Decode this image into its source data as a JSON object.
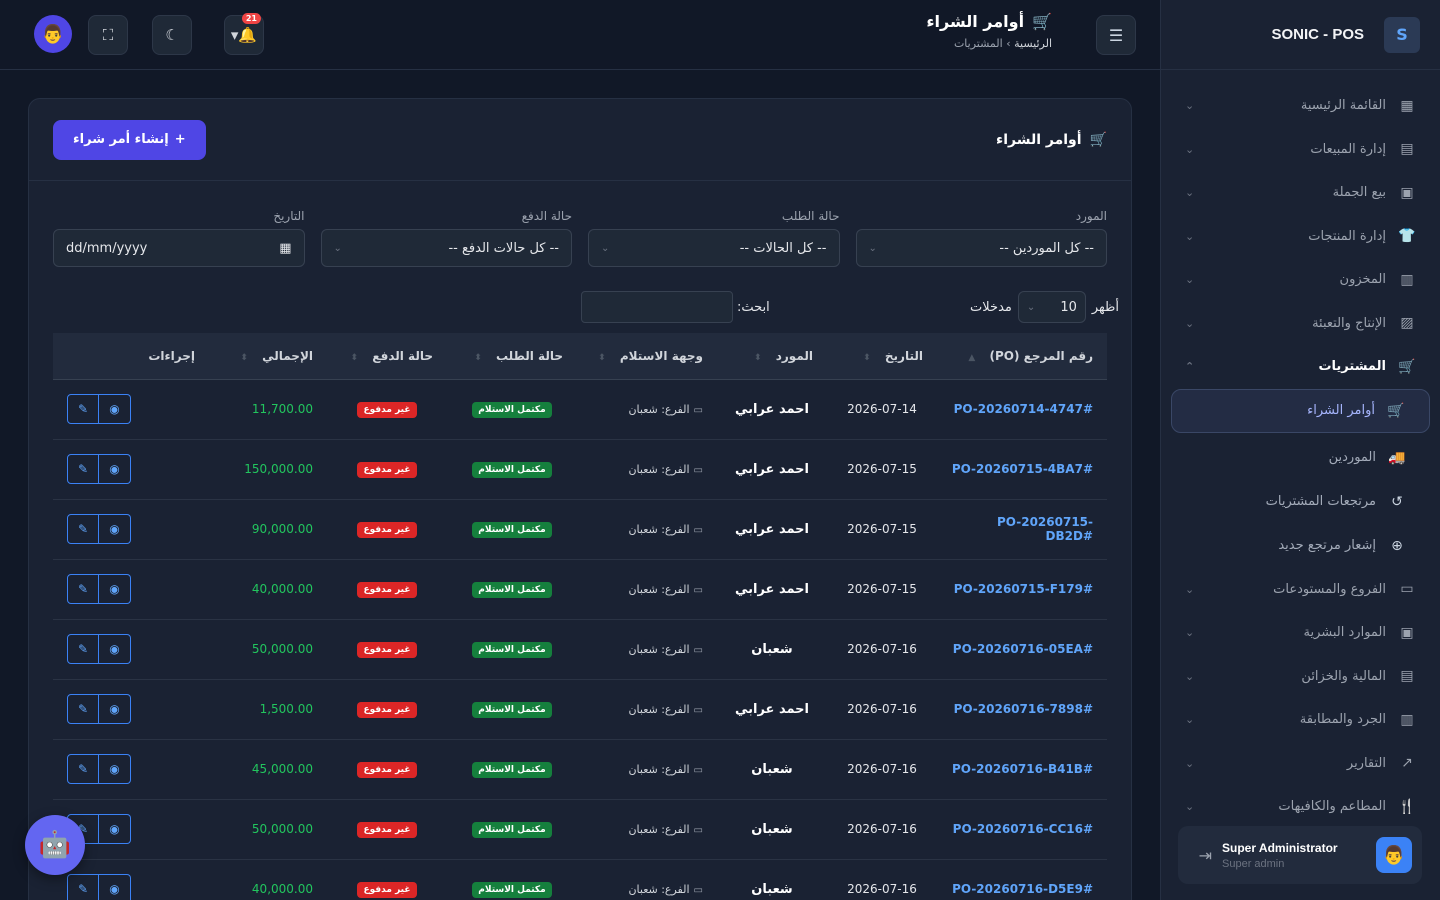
{
  "brand": {
    "name": "SONIC - POS",
    "logo_letter": "S"
  },
  "header": {
    "title": "أوامر الشراء",
    "crumb_home": "الرئيسية",
    "crumb_sep": "›",
    "crumb_current": "المشتريات",
    "notifications": "21"
  },
  "sidebar": {
    "items": [
      {
        "label": "القائمة الرئيسية",
        "icon": "▦"
      },
      {
        "label": "إدارة المبيعات",
        "icon": "▤"
      },
      {
        "label": "بيع الجملة",
        "icon": "▣"
      },
      {
        "label": "إدارة المنتجات",
        "icon": "👕"
      },
      {
        "label": "المخزون",
        "icon": "▥"
      },
      {
        "label": "الإنتاج والتعبئة",
        "icon": "▨"
      },
      {
        "label": "المشتريات",
        "icon": "🛒"
      }
    ],
    "sub_items": [
      {
        "label": "أوامر الشراء",
        "icon": "🛒"
      },
      {
        "label": "الموردين",
        "icon": "🚚"
      },
      {
        "label": "مرتجعات المشتريات",
        "icon": "↺"
      },
      {
        "label": "إشعار مرتجع جديد",
        "icon": "⊕"
      }
    ],
    "items_after": [
      {
        "label": "الفروع والمستودعات",
        "icon": "▭"
      },
      {
        "label": "الموارد البشرية",
        "icon": "▣"
      },
      {
        "label": "المالية والخزائن",
        "icon": "▤"
      },
      {
        "label": "الجرد والمطابقة",
        "icon": "▥"
      },
      {
        "label": "التقارير",
        "icon": "↗"
      },
      {
        "label": "المطاعم والكافيهات",
        "icon": "🍴"
      }
    ],
    "user": {
      "name": "Super Administrator",
      "role": "Super admin"
    }
  },
  "card": {
    "title": "أوامر الشراء",
    "create_label": "إنشاء أمر شراء"
  },
  "filters": {
    "supplier": {
      "label": "المورد",
      "value": "-- كل الموردين --"
    },
    "order_status": {
      "label": "حالة الطلب",
      "value": "-- كل الحالات --"
    },
    "payment_status": {
      "label": "حالة الدفع",
      "value": "-- كل حالات الدفع --"
    },
    "date": {
      "label": "التاريخ",
      "placeholder": "dd/mm/yyyy"
    }
  },
  "table_controls": {
    "show": "أظهر",
    "length": "10",
    "entries": "مدخلات",
    "search": "ابحث:"
  },
  "table": {
    "headers": [
      "رقم المرجع (PO)",
      "التاريخ",
      "المورد",
      "وجهة الاستلام",
      "حالة الطلب",
      "حالة الدفع",
      "الإجمالي",
      "إجراءات"
    ],
    "rows": [
      {
        "ref": "PO-20260714-4747#",
        "date": "2026-07-14",
        "supplier": "احمد عرابي",
        "dest": "الفرع: شعبان",
        "order": "مكتمل الاستلام",
        "pay": "غير مدفوع",
        "total": "11,700.00"
      },
      {
        "ref": "PO-20260715-4BA7#",
        "date": "2026-07-15",
        "supplier": "احمد عرابي",
        "dest": "الفرع: شعبان",
        "order": "مكتمل الاستلام",
        "pay": "غير مدفوع",
        "total": "150,000.00"
      },
      {
        "ref": "PO-20260715-DB2D#",
        "date": "2026-07-15",
        "supplier": "احمد عرابي",
        "dest": "الفرع: شعبان",
        "order": "مكتمل الاستلام",
        "pay": "غير مدفوع",
        "total": "90,000.00"
      },
      {
        "ref": "PO-20260715-F179#",
        "date": "2026-07-15",
        "supplier": "احمد عرابي",
        "dest": "الفرع: شعبان",
        "order": "مكتمل الاستلام",
        "pay": "غير مدفوع",
        "total": "40,000.00"
      },
      {
        "ref": "PO-20260716-05EA#",
        "date": "2026-07-16",
        "supplier": "شعبان",
        "dest": "الفرع: شعبان",
        "order": "مكتمل الاستلام",
        "pay": "غير مدفوع",
        "total": "50,000.00"
      },
      {
        "ref": "PO-20260716-7898#",
        "date": "2026-07-16",
        "supplier": "احمد عرابي",
        "dest": "الفرع: شعبان",
        "order": "مكتمل الاستلام",
        "pay": "غير مدفوع",
        "total": "1,500.00"
      },
      {
        "ref": "PO-20260716-B41B#",
        "date": "2026-07-16",
        "supplier": "شعبان",
        "dest": "الفرع: شعبان",
        "order": "مكتمل الاستلام",
        "pay": "غير مدفوع",
        "total": "45,000.00"
      },
      {
        "ref": "PO-20260716-CC16#",
        "date": "2026-07-16",
        "supplier": "شعبان",
        "dest": "الفرع: شعبان",
        "order": "مكتمل الاستلام",
        "pay": "غير مدفوع",
        "total": "50,000.00"
      },
      {
        "ref": "PO-20260716-D5E9#",
        "date": "2026-07-16",
        "supplier": "شعبان",
        "dest": "الفرع: شعبان",
        "order": "مكتمل الاستلام",
        "pay": "غير مدفوع",
        "total": "40,000.00"
      }
    ]
  }
}
